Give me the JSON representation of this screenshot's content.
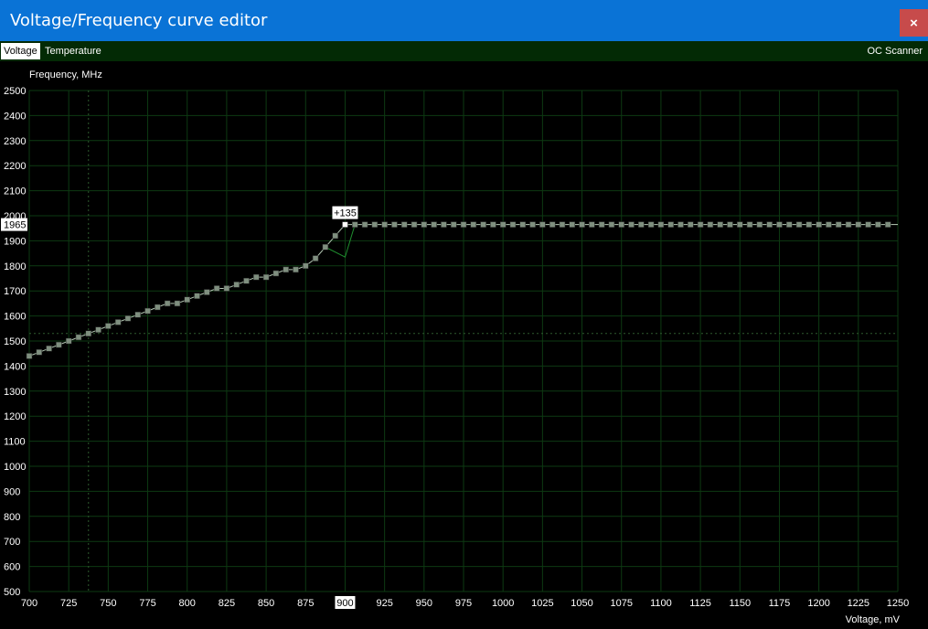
{
  "window": {
    "title": "Voltage/Frequency curve editor",
    "close_label": "×"
  },
  "tabs": [
    {
      "label": "Voltage",
      "active": true
    },
    {
      "label": "Temperature",
      "active": false
    }
  ],
  "oc_scanner_label": "OC Scanner",
  "colors": {
    "title_bar": "#0a73d6",
    "close_button": "#c74b4b",
    "tab_bar": "#032a05",
    "grid": "#0d3a12",
    "curve_line": "#b4c8b4",
    "point_fill": "#7f8f7f",
    "selected_point": "#ffffff",
    "crosshair": "#2f5a2f"
  },
  "chart_data": {
    "type": "line",
    "xlabel": "Voltage, mV",
    "ylabel": "Frequency, MHz",
    "xlim": [
      700,
      1250
    ],
    "ylim": [
      500,
      2500
    ],
    "x_ticks": [
      700,
      725,
      750,
      775,
      800,
      825,
      850,
      875,
      900,
      925,
      950,
      975,
      1000,
      1025,
      1050,
      1075,
      1100,
      1125,
      1150,
      1175,
      1200,
      1225,
      1250
    ],
    "y_ticks": [
      500,
      600,
      700,
      800,
      900,
      1000,
      1100,
      1200,
      1300,
      1400,
      1500,
      1600,
      1700,
      1800,
      1900,
      2000,
      2100,
      2200,
      2300,
      2400,
      2500
    ],
    "grid": true,
    "series": [
      {
        "x": [
          700,
          706.25,
          712.5,
          718.75,
          725,
          731.25,
          737.5,
          743.75,
          750,
          756.25,
          762.5,
          768.75,
          775,
          781.25,
          787.5,
          793.75,
          800,
          806.25,
          812.5,
          818.75,
          825,
          831.25,
          837.5,
          843.75,
          850,
          856.25,
          862.5,
          868.75,
          875,
          881.25,
          887.5,
          893.75,
          900,
          906.25,
          912.5,
          918.75,
          925,
          931.25,
          937.5,
          943.75,
          950,
          956.25,
          962.5,
          968.75,
          975,
          981.25,
          987.5,
          993.75,
          1000,
          1006.25,
          1012.5,
          1018.75,
          1025,
          1031.25,
          1037.5,
          1043.75,
          1050,
          1056.25,
          1062.5,
          1068.75,
          1075,
          1081.25,
          1087.5,
          1093.75,
          1100,
          1106.25,
          1112.5,
          1118.75,
          1125,
          1131.25,
          1137.5,
          1143.75,
          1150,
          1156.25,
          1162.5,
          1168.75,
          1175,
          1181.25,
          1187.5,
          1193.75,
          1200,
          1206.25,
          1212.5,
          1218.75,
          1225,
          1231.25,
          1237.5,
          1243.75
        ],
        "values": [
          1440,
          1455,
          1470,
          1485,
          1500,
          1515,
          1530,
          1545,
          1560,
          1575,
          1590,
          1605,
          1620,
          1635,
          1650,
          1650,
          1665,
          1680,
          1695,
          1710,
          1710,
          1725,
          1740,
          1755,
          1755,
          1770,
          1785,
          1785,
          1800,
          1830,
          1875,
          1920,
          1965,
          1965,
          1965,
          1965,
          1965,
          1965,
          1965,
          1965,
          1965,
          1965,
          1965,
          1965,
          1965,
          1965,
          1965,
          1965,
          1965,
          1965,
          1965,
          1965,
          1965,
          1965,
          1965,
          1965,
          1965,
          1965,
          1965,
          1965,
          1965,
          1965,
          1965,
          1965,
          1965,
          1965,
          1965,
          1965,
          1965,
          1965,
          1965,
          1965,
          1965,
          1965,
          1965,
          1965,
          1965,
          1965,
          1965,
          1965,
          1965,
          1965,
          1965,
          1965,
          1965,
          1965,
          1965,
          1965
        ]
      }
    ],
    "selected_point": {
      "x": 900,
      "y": 1965,
      "offset_label": "+135",
      "x_label": "900",
      "y_label": "1965"
    },
    "crosshair": {
      "x": 737.5,
      "y": 1530
    }
  }
}
